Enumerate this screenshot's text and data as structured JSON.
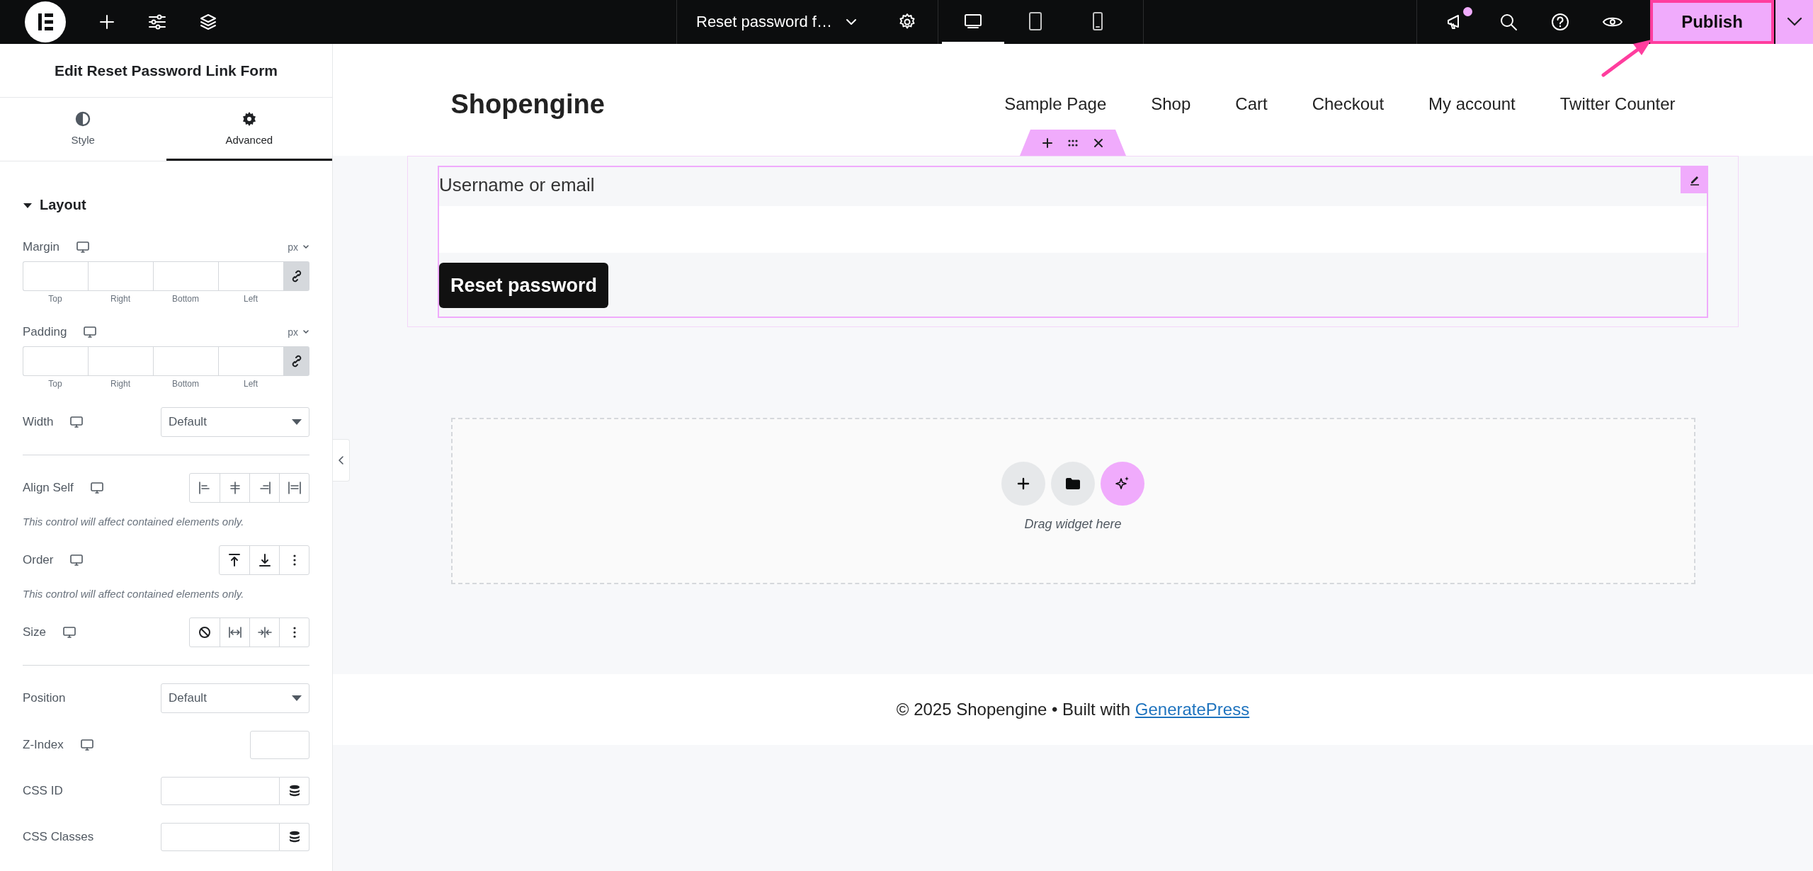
{
  "top_bar": {
    "document_title": "Reset password f…",
    "devices": [
      {
        "kind": "desktop",
        "selected": true
      },
      {
        "kind": "tablet",
        "selected": false
      },
      {
        "kind": "mobile",
        "selected": false
      }
    ],
    "announcements_unread": true,
    "publish": "Publish"
  },
  "panel": {
    "title": "Edit Reset Password Link Form",
    "tabs": [
      {
        "kind": "style",
        "label": "Style",
        "selected": false
      },
      {
        "kind": "advanced",
        "label": "Advanced",
        "selected": true
      }
    ],
    "section": {
      "title": "Layout",
      "expanded": true
    },
    "controls": [
      {
        "kind": "dimensions",
        "label": "Margin",
        "responsive": true,
        "unit": "px",
        "linked": true,
        "sides": [
          "Top",
          "Right",
          "Bottom",
          "Left"
        ]
      },
      {
        "kind": "dimensions",
        "label": "Padding",
        "responsive": true,
        "unit": "px",
        "linked": true,
        "sides": [
          "Top",
          "Right",
          "Bottom",
          "Left"
        ]
      },
      {
        "kind": "select",
        "label": "Width",
        "responsive": true,
        "value": "Default"
      },
      {
        "kind": "divider"
      },
      {
        "kind": "choices",
        "label": "Align Self",
        "responsive": true,
        "options": [
          {
            "kind": "start"
          },
          {
            "kind": "center"
          },
          {
            "kind": "end"
          },
          {
            "kind": "stretch"
          }
        ],
        "note": "This control will affect contained elements only."
      },
      {
        "kind": "choices",
        "label": "Order",
        "responsive": true,
        "options": [
          {
            "kind": "first"
          },
          {
            "kind": "last"
          },
          {
            "kind": "more"
          }
        ],
        "note": "This control will affect contained elements only."
      },
      {
        "kind": "choices",
        "label": "Size",
        "responsive": true,
        "options": [
          {
            "kind": "none"
          },
          {
            "kind": "grow"
          },
          {
            "kind": "shrink"
          },
          {
            "kind": "more"
          }
        ]
      },
      {
        "kind": "divider"
      },
      {
        "kind": "select",
        "label": "Position",
        "responsive": false,
        "value": "Default"
      },
      {
        "kind": "number",
        "label": "Z-Index",
        "responsive": true
      },
      {
        "kind": "dynamic",
        "label": "CSS ID",
        "responsive": false
      },
      {
        "kind": "dynamic",
        "label": "CSS Classes",
        "responsive": false
      }
    ]
  },
  "canvas": {
    "site_title": "Shopengine",
    "nav": [
      "Sample Page",
      "Shop",
      "Cart",
      "Checkout",
      "My account",
      "Twitter Counter"
    ],
    "form": {
      "selected": true,
      "label": "Username or email",
      "button": "Reset password"
    },
    "drop_zone": {
      "hint": "Drag widget here"
    },
    "footer": {
      "text": "© 2025 Shopengine • Built with ",
      "link": "GeneratePress"
    }
  }
}
